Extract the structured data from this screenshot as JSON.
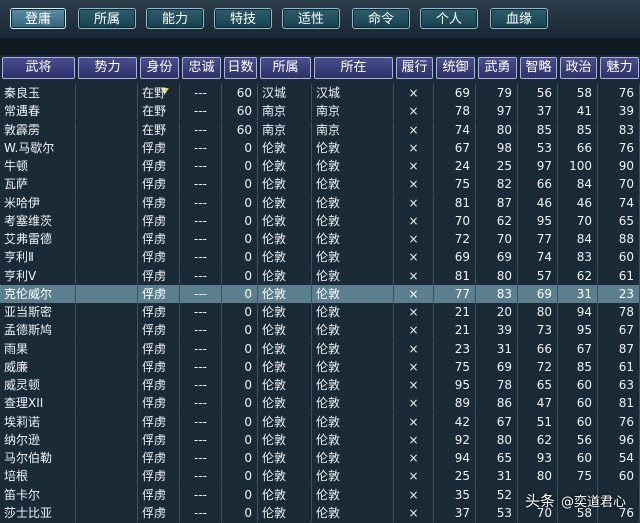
{
  "tabs": [
    "登庸",
    "所属",
    "能力",
    "特技",
    "适性",
    "命令",
    "个人",
    "血缘"
  ],
  "columns": [
    "武将",
    "势力",
    "身份",
    "忠诚",
    "日数",
    "所属",
    "所在",
    "履行",
    "统御",
    "武勇",
    "智略",
    "政治",
    "魅力"
  ],
  "sort_indicator": "▼",
  "rows": [
    [
      "秦良玉",
      "",
      "在野",
      "---",
      "60",
      "汉城",
      "汉城",
      "×",
      "69",
      "79",
      "56",
      "58",
      "76"
    ],
    [
      "常遇春",
      "",
      "在野",
      "---",
      "60",
      "南京",
      "南京",
      "×",
      "78",
      "97",
      "37",
      "41",
      "39"
    ],
    [
      "敦霹雳",
      "",
      "在野",
      "---",
      "60",
      "南京",
      "南京",
      "×",
      "74",
      "80",
      "85",
      "85",
      "83"
    ],
    [
      "W.马歇尔",
      "",
      "俘虏",
      "---",
      "0",
      "伦敦",
      "伦敦",
      "×",
      "67",
      "98",
      "53",
      "66",
      "76"
    ],
    [
      "牛顿",
      "",
      "俘虏",
      "---",
      "0",
      "伦敦",
      "伦敦",
      "×",
      "24",
      "25",
      "97",
      "100",
      "90"
    ],
    [
      "瓦萨",
      "",
      "俘虏",
      "---",
      "0",
      "伦敦",
      "伦敦",
      "×",
      "75",
      "82",
      "66",
      "84",
      "70"
    ],
    [
      "米哈伊",
      "",
      "俘虏",
      "---",
      "0",
      "伦敦",
      "伦敦",
      "×",
      "81",
      "87",
      "46",
      "46",
      "74"
    ],
    [
      "考塞维茨",
      "",
      "俘虏",
      "---",
      "0",
      "伦敦",
      "伦敦",
      "×",
      "70",
      "62",
      "95",
      "70",
      "65"
    ],
    [
      "艾弗雷德",
      "",
      "俘虏",
      "---",
      "0",
      "伦敦",
      "伦敦",
      "×",
      "72",
      "70",
      "77",
      "84",
      "88"
    ],
    [
      "亨利Ⅱ",
      "",
      "俘虏",
      "---",
      "0",
      "伦敦",
      "伦敦",
      "×",
      "69",
      "69",
      "74",
      "83",
      "60"
    ],
    [
      "亨利Ⅴ",
      "",
      "俘虏",
      "---",
      "0",
      "伦敦",
      "伦敦",
      "×",
      "81",
      "80",
      "57",
      "62",
      "61"
    ],
    [
      "克伦威尔",
      "",
      "俘虏",
      "---",
      "0",
      "伦敦",
      "伦敦",
      "×",
      "77",
      "83",
      "69",
      "31",
      "23"
    ],
    [
      "亚当斯密",
      "",
      "俘虏",
      "---",
      "0",
      "伦敦",
      "伦敦",
      "×",
      "21",
      "20",
      "80",
      "94",
      "78"
    ],
    [
      "孟德斯鸠",
      "",
      "俘虏",
      "---",
      "0",
      "伦敦",
      "伦敦",
      "×",
      "21",
      "39",
      "73",
      "95",
      "67"
    ],
    [
      "雨果",
      "",
      "俘虏",
      "---",
      "0",
      "伦敦",
      "伦敦",
      "×",
      "23",
      "31",
      "66",
      "67",
      "87"
    ],
    [
      "威廉",
      "",
      "俘虏",
      "---",
      "0",
      "伦敦",
      "伦敦",
      "×",
      "75",
      "69",
      "72",
      "85",
      "61"
    ],
    [
      "威灵顿",
      "",
      "俘虏",
      "---",
      "0",
      "伦敦",
      "伦敦",
      "×",
      "95",
      "78",
      "65",
      "60",
      "63"
    ],
    [
      "查理XII",
      "",
      "俘虏",
      "---",
      "0",
      "伦敦",
      "伦敦",
      "×",
      "89",
      "86",
      "47",
      "60",
      "81"
    ],
    [
      "埃莉诺",
      "",
      "俘虏",
      "---",
      "0",
      "伦敦",
      "伦敦",
      "×",
      "42",
      "67",
      "51",
      "60",
      "76"
    ],
    [
      "纳尔逊",
      "",
      "俘虏",
      "---",
      "0",
      "伦敦",
      "伦敦",
      "×",
      "92",
      "80",
      "62",
      "56",
      "96"
    ],
    [
      "马尔伯勒",
      "",
      "俘虏",
      "---",
      "0",
      "伦敦",
      "伦敦",
      "×",
      "94",
      "65",
      "93",
      "60",
      "54"
    ],
    [
      "培根",
      "",
      "俘虏",
      "---",
      "0",
      "伦敦",
      "伦敦",
      "×",
      "25",
      "31",
      "80",
      "75",
      "60"
    ],
    [
      "笛卡尔",
      "",
      "俘虏",
      "---",
      "0",
      "伦敦",
      "伦敦",
      "×",
      "35",
      "52",
      "",
      "",
      ""
    ],
    [
      "莎士比亚",
      "",
      "俘虏",
      "---",
      "0",
      "伦敦",
      "伦敦",
      "×",
      "37",
      "53",
      "70",
      "58",
      "76"
    ]
  ],
  "highlighted_row": 11,
  "watermark": {
    "brand": "头条",
    "handle": "@奕道君心"
  },
  "colors": {
    "highlight": "#5b7f8e",
    "header": "#3e4280",
    "accent": "#e6d35a"
  }
}
